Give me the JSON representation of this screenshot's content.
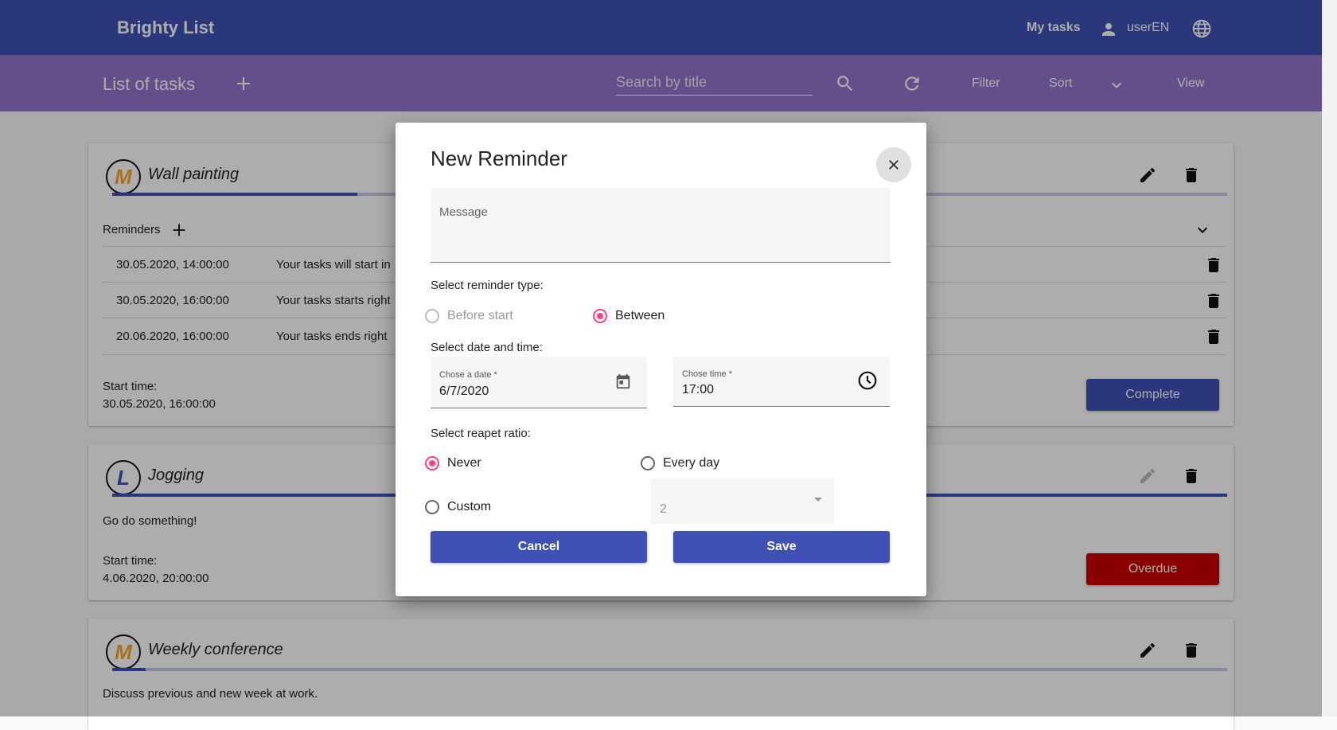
{
  "app": {
    "brand": "Brighty List",
    "nav_my_tasks": "My tasks",
    "username": "userEN"
  },
  "toolbar": {
    "title": "List of tasks",
    "search_placeholder": "Search by title",
    "filter_label": "Filter",
    "sort_label": "Sort",
    "view_label": "View"
  },
  "tasks": [
    {
      "avatar_letter": "M",
      "avatar_color": "#f9a825",
      "title": "Wall painting",
      "progress": 0.22,
      "reminders_label": "Reminders",
      "reminders": [
        {
          "date": "30.05.2020, 14:00:00",
          "message": "Your tasks will start in"
        },
        {
          "date": "30.05.2020, 16:00:00",
          "message": "Your tasks starts right"
        },
        {
          "date": "20.06.2020, 16:00:00",
          "message": "Your tasks ends right"
        }
      ],
      "start_label": "Start time:",
      "start_time": "30.05.2020, 16:00:00",
      "status_label": "Complete",
      "status_color": "#3f51b5"
    },
    {
      "avatar_letter": "L",
      "avatar_color": "#3f51b5",
      "title": "Jogging",
      "progress": 1.0,
      "description": "Go do something!",
      "start_label": "Start time:",
      "start_time": "4.06.2020, 20:00:00",
      "status_label": "Overdue",
      "status_color": "#cc0000"
    },
    {
      "avatar_letter": "M",
      "avatar_color": "#f9a825",
      "title": "Weekly conference",
      "progress": 0.03,
      "description": "Discuss previous and new week at work."
    }
  ],
  "dialog": {
    "title": "New Reminder",
    "message_label": "Message",
    "type_label": "Select reminder type:",
    "type_options": [
      "Before start",
      "Between"
    ],
    "type_selected": "Between",
    "datetime_label": "Select date and time:",
    "date_label": "Chose a date *",
    "date_value": "6/7/2020",
    "time_label": "Chose time *",
    "time_value": "17:00",
    "repeat_label": "Select reapet ratio:",
    "repeat_options": [
      "Never",
      "Every day",
      "Custom"
    ],
    "repeat_selected": "Never",
    "custom_value": "2",
    "cancel_label": "Cancel",
    "save_label": "Save"
  }
}
